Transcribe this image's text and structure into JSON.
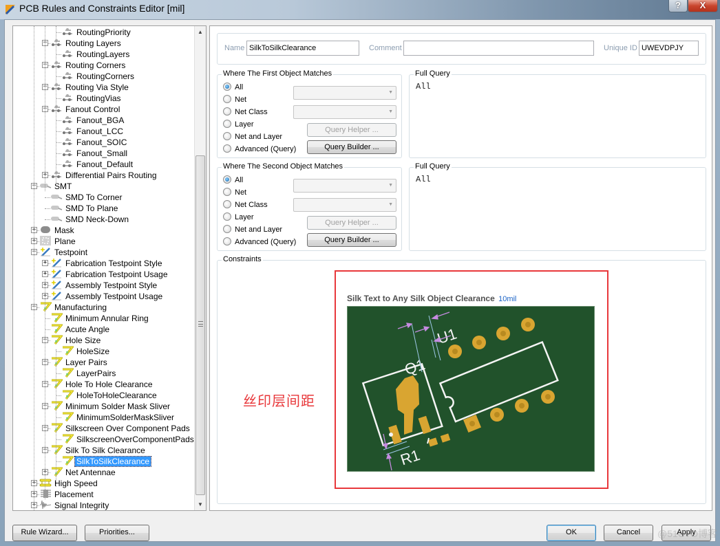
{
  "window": {
    "title": "PCB Rules and Constraints Editor [mil]",
    "help_label": "?",
    "close_label": "X"
  },
  "tree": {
    "items": [
      {
        "label": "RoutingPriority",
        "level": 3,
        "icon": "routing-rule-icon",
        "expander": null
      },
      {
        "label": "Routing Layers",
        "level": 2,
        "icon": "routing-rule-icon",
        "expander": "minus"
      },
      {
        "label": "RoutingLayers",
        "level": 3,
        "icon": "routing-rule-icon",
        "expander": null
      },
      {
        "label": "Routing Corners",
        "level": 2,
        "icon": "routing-rule-icon",
        "expander": "minus"
      },
      {
        "label": "RoutingCorners",
        "level": 3,
        "icon": "routing-rule-icon",
        "expander": null
      },
      {
        "label": "Routing Via Style",
        "level": 2,
        "icon": "routing-rule-icon",
        "expander": "minus"
      },
      {
        "label": "RoutingVias",
        "level": 3,
        "icon": "routing-rule-icon",
        "expander": null
      },
      {
        "label": "Fanout Control",
        "level": 2,
        "icon": "routing-rule-icon",
        "expander": "minus"
      },
      {
        "label": "Fanout_BGA",
        "level": 3,
        "icon": "routing-rule-icon",
        "expander": null
      },
      {
        "label": "Fanout_LCC",
        "level": 3,
        "icon": "routing-rule-icon",
        "expander": null
      },
      {
        "label": "Fanout_SOIC",
        "level": 3,
        "icon": "routing-rule-icon",
        "expander": null
      },
      {
        "label": "Fanout_Small",
        "level": 3,
        "icon": "routing-rule-icon",
        "expander": null
      },
      {
        "label": "Fanout_Default",
        "level": 3,
        "icon": "routing-rule-icon",
        "expander": null
      },
      {
        "label": "Differential Pairs Routing",
        "level": 2,
        "icon": "routing-rule-icon",
        "expander": "plus"
      },
      {
        "label": "SMT",
        "level": 1,
        "icon": "smt-icon",
        "expander": "minus"
      },
      {
        "label": "SMD To Corner",
        "level": 2,
        "icon": "smt-icon",
        "expander": null
      },
      {
        "label": "SMD To Plane",
        "level": 2,
        "icon": "smt-icon",
        "expander": null
      },
      {
        "label": "SMD Neck-Down",
        "level": 2,
        "icon": "smt-icon",
        "expander": null
      },
      {
        "label": "Mask",
        "level": 1,
        "icon": "mask-icon",
        "expander": "plus"
      },
      {
        "label": "Plane",
        "level": 1,
        "icon": "plane-icon",
        "expander": "plus"
      },
      {
        "label": "Testpoint",
        "level": 1,
        "icon": "testpoint-icon",
        "expander": "minus"
      },
      {
        "label": "Fabrication Testpoint Style",
        "level": 2,
        "icon": "testpoint-icon",
        "expander": "plus"
      },
      {
        "label": "Fabrication Testpoint Usage",
        "level": 2,
        "icon": "testpoint-icon",
        "expander": "plus"
      },
      {
        "label": "Assembly Testpoint Style",
        "level": 2,
        "icon": "testpoint-icon",
        "expander": "plus"
      },
      {
        "label": "Assembly Testpoint Usage",
        "level": 2,
        "icon": "testpoint-icon",
        "expander": "plus"
      },
      {
        "label": "Manufacturing",
        "level": 1,
        "icon": "manufacturing-icon",
        "expander": "minus"
      },
      {
        "label": "Minimum Annular Ring",
        "level": 2,
        "icon": "manufacturing-icon",
        "expander": null
      },
      {
        "label": "Acute Angle",
        "level": 2,
        "icon": "manufacturing-icon",
        "expander": null
      },
      {
        "label": "Hole Size",
        "level": 2,
        "icon": "manufacturing-icon",
        "expander": "minus"
      },
      {
        "label": "HoleSize",
        "level": 3,
        "icon": "manufacturing-icon",
        "expander": null
      },
      {
        "label": "Layer Pairs",
        "level": 2,
        "icon": "manufacturing-icon",
        "expander": "minus"
      },
      {
        "label": "LayerPairs",
        "level": 3,
        "icon": "manufacturing-icon",
        "expander": null
      },
      {
        "label": "Hole To Hole Clearance",
        "level": 2,
        "icon": "manufacturing-icon",
        "expander": "minus"
      },
      {
        "label": "HoleToHoleClearance",
        "level": 3,
        "icon": "manufacturing-icon",
        "expander": null
      },
      {
        "label": "Minimum Solder Mask Sliver",
        "level": 2,
        "icon": "manufacturing-icon",
        "expander": "minus"
      },
      {
        "label": "MinimumSolderMaskSliver",
        "level": 3,
        "icon": "manufacturing-icon",
        "expander": null
      },
      {
        "label": "Silkscreen Over Component Pads",
        "level": 2,
        "icon": "manufacturing-icon",
        "expander": "minus"
      },
      {
        "label": "SilkscreenOverComponentPads",
        "level": 3,
        "icon": "manufacturing-icon",
        "expander": null
      },
      {
        "label": "Silk To Silk Clearance",
        "level": 2,
        "icon": "manufacturing-icon",
        "expander": "minus"
      },
      {
        "label": "SilkToSilkClearance",
        "level": 3,
        "icon": "manufacturing-icon",
        "expander": null,
        "selected": true
      },
      {
        "label": "Net Antennae",
        "level": 2,
        "icon": "manufacturing-icon",
        "expander": "plus"
      },
      {
        "label": "High Speed",
        "level": 1,
        "icon": "high-speed-icon",
        "expander": "plus"
      },
      {
        "label": "Placement",
        "level": 1,
        "icon": "placement-icon",
        "expander": "plus"
      },
      {
        "label": "Signal Integrity",
        "level": 1,
        "icon": "signal-integrity-icon",
        "expander": "plus"
      }
    ]
  },
  "rule": {
    "name_label": "Name",
    "name_value": "SilkToSilkClearance",
    "comment_label": "Comment",
    "comment_value": "",
    "uid_label": "Unique ID",
    "uid_value": "UWEVDPJY"
  },
  "first_match": {
    "title": "Where The First Object Matches",
    "options": [
      "All",
      "Net",
      "Net Class",
      "Layer",
      "Net and Layer",
      "Advanced (Query)"
    ],
    "selected": "All",
    "query_helper": "Query Helper ...",
    "query_builder": "Query Builder ...",
    "full_query_title": "Full Query",
    "full_query": "All"
  },
  "second_match": {
    "title": "Where The Second Object Matches",
    "options": [
      "All",
      "Net",
      "Net Class",
      "Layer",
      "Net and Layer",
      "Advanced (Query)"
    ],
    "selected": "All",
    "query_helper": "Query Helper ...",
    "query_builder": "Query Builder ...",
    "full_query_title": "Full Query",
    "full_query": "All"
  },
  "constraints": {
    "title": "Constraints",
    "diagram_title": "Silk Text to Any Silk Object Clearance",
    "clearance_value": "10mil",
    "labels": {
      "q1": "Q1",
      "u1": "U1",
      "r1": "R1"
    },
    "annotation": "丝印层间距",
    "annotation_color": "#e8373a"
  },
  "footer": {
    "rule_wizard": "Rule Wizard...",
    "priorities": "Priorities...",
    "ok": "OK",
    "cancel": "Cancel",
    "apply": "Apply",
    "watermark": "@51CTO博客"
  }
}
